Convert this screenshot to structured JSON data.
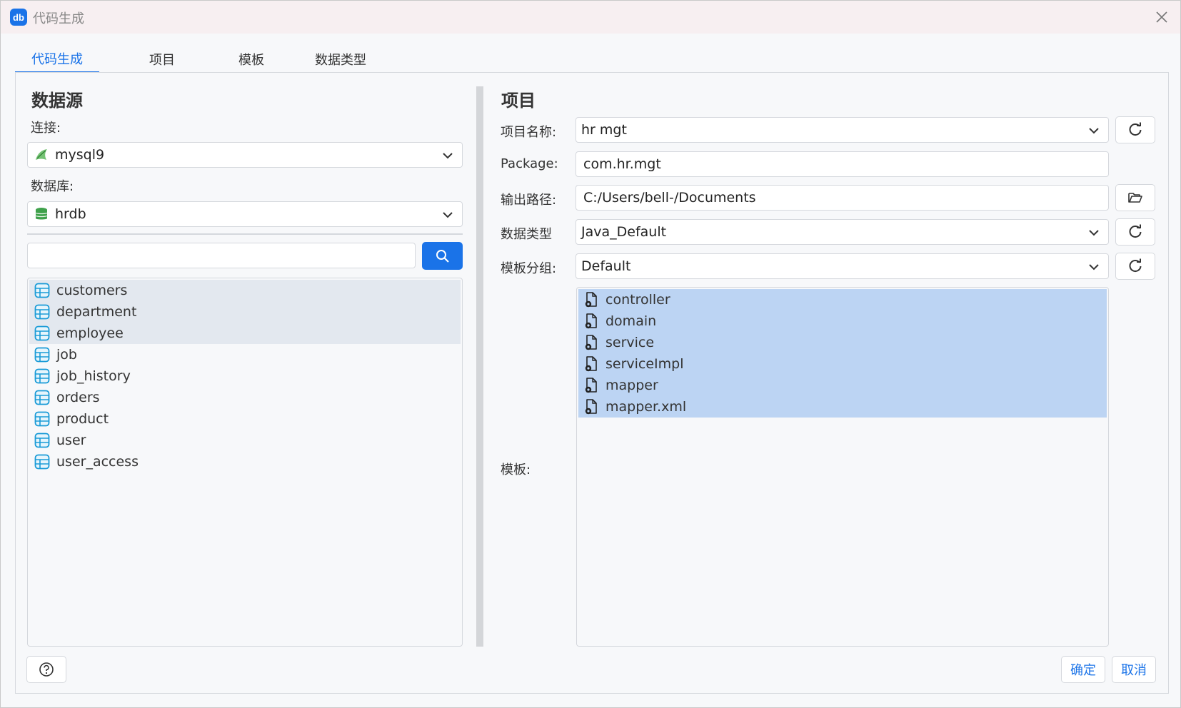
{
  "window": {
    "title": "代码生成",
    "app_icon_text": "db"
  },
  "tabs": [
    {
      "label": "代码生成",
      "active": true
    },
    {
      "label": "项目",
      "active": false
    },
    {
      "label": "模板",
      "active": false
    },
    {
      "label": "数据类型",
      "active": false
    }
  ],
  "datasource": {
    "title": "数据源",
    "connection_label": "连接:",
    "connection_value": "mysql9",
    "database_label": "数据库:",
    "database_value": "hrdb",
    "search_value": "",
    "tables": [
      {
        "name": "customers",
        "selected": true
      },
      {
        "name": "department",
        "selected": true
      },
      {
        "name": "employee",
        "selected": true
      },
      {
        "name": "job",
        "selected": false
      },
      {
        "name": "job_history",
        "selected": false
      },
      {
        "name": "orders",
        "selected": false
      },
      {
        "name": "product",
        "selected": false
      },
      {
        "name": "user",
        "selected": false
      },
      {
        "name": "user_access",
        "selected": false
      }
    ]
  },
  "project": {
    "title": "项目",
    "name_label": "项目名称:",
    "name_value": "hr mgt",
    "package_label": "Package:",
    "package_value": "com.hr.mgt",
    "output_label": "输出路径:",
    "output_value": "C:/Users/bell-/Documents",
    "datatype_label": "数据类型",
    "datatype_value": "Java_Default",
    "template_group_label": "模板分组:",
    "template_group_value": "Default",
    "templates_label": "模板:",
    "templates": [
      {
        "name": "controller",
        "selected": true
      },
      {
        "name": "domain",
        "selected": true
      },
      {
        "name": "service",
        "selected": true
      },
      {
        "name": "serviceImpl",
        "selected": true
      },
      {
        "name": "mapper",
        "selected": true
      },
      {
        "name": "mapper.xml",
        "selected": true
      }
    ]
  },
  "footer": {
    "ok_label": "确定",
    "cancel_label": "取消"
  },
  "colors": {
    "accent": "#1a73e8",
    "selection": "#bcd4f3",
    "table_icon": "#1a9bd7",
    "db_icon": "#3fa14b"
  }
}
